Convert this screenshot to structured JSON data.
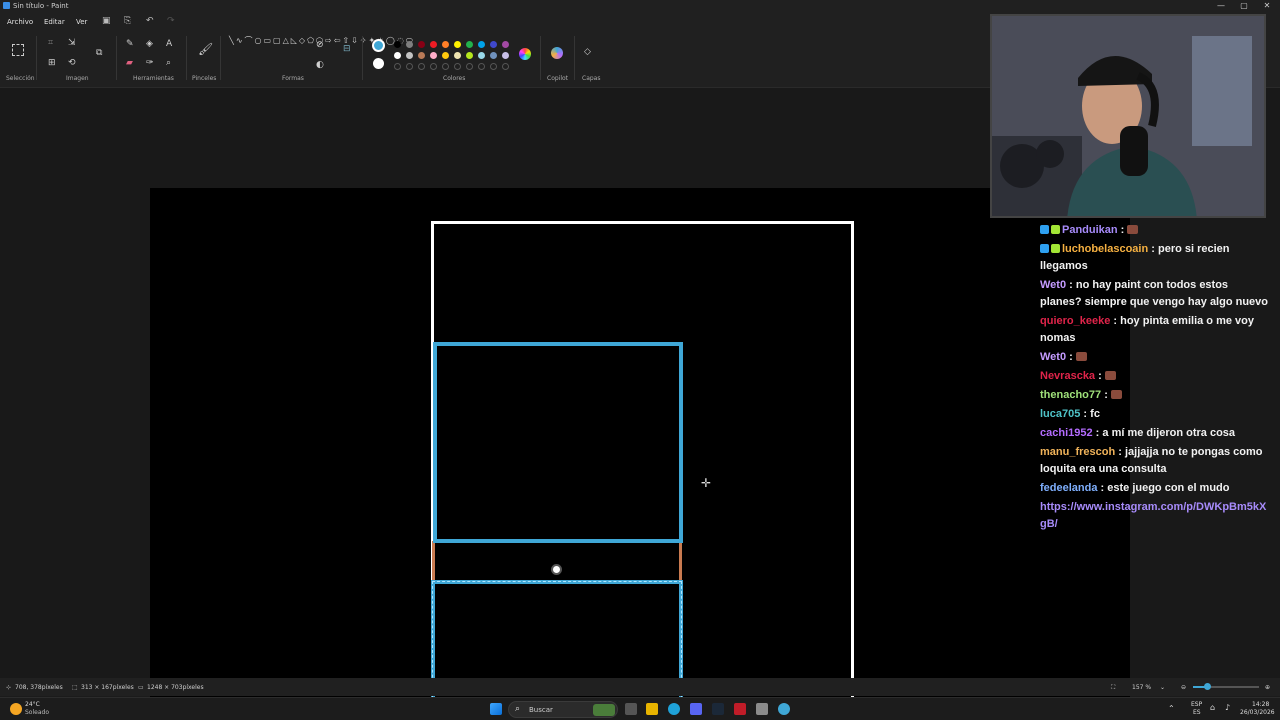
{
  "window": {
    "title": "Sin título - Paint",
    "controls": [
      "—",
      "▢",
      "✕"
    ]
  },
  "menu": {
    "items": [
      "Archivo",
      "Editar",
      "Ver"
    ]
  },
  "ribbon": {
    "groups": {
      "seleccion": "Selección",
      "imagen": "Imagen",
      "herramientas": "Herramientas",
      "pinceles": "Pinceles",
      "formas": "Formas",
      "colores": "Colores",
      "copilot": "Copilot",
      "capas": "Capas"
    },
    "colors": {
      "primary": "#3fa7d6",
      "secondary": "#ffffff",
      "palette_row1": [
        "#000000",
        "#7f7f7f",
        "#880015",
        "#ed1c24",
        "#ff7f27",
        "#fff200",
        "#22b14c",
        "#00a2e8",
        "#3f48cc",
        "#a349a4"
      ],
      "palette_row2": [
        "#ffffff",
        "#c3c3c3",
        "#b97a57",
        "#ffaec9",
        "#ffc90e",
        "#efe4b0",
        "#b5e61d",
        "#99d9ea",
        "#7092be",
        "#c8bfe7"
      ]
    }
  },
  "canvas": {
    "background": "#000000",
    "shape_colors": {
      "outline": "#ffffff",
      "blue": "#3fa7d6",
      "orange": "#c97a50"
    }
  },
  "chat": {
    "messages": [
      {
        "user": "Panduikan",
        "text": "",
        "color": "#a78bfa",
        "emote": true
      },
      {
        "user": "luchobelascoain",
        "text": "pero si recien llegamos",
        "color": "#f5b041"
      },
      {
        "user": "Wet0",
        "text": "no hay paint con todos estos planes? siempre que vengo hay algo nuevo",
        "color": "#c49bff"
      },
      {
        "user": "quiero_keeke",
        "text": "hoy pinta emilia o me voy nomas",
        "color": "#e0244a"
      },
      {
        "user": "Wet0",
        "text": "",
        "color": "#c49bff",
        "emote": true
      },
      {
        "user": "Nevrascka",
        "text": "",
        "color": "#e0244a",
        "emote": true
      },
      {
        "user": "thenacho77",
        "text": "",
        "color": "#9fe07a",
        "emote": true
      },
      {
        "user": "luca705",
        "text": "fc",
        "color": "#4fc3c8"
      },
      {
        "user": "cachi1952",
        "text": "a mí me dijeron otra cosa",
        "color": "#b46cff"
      },
      {
        "user": "manu_frescoh",
        "text": "jajjajja no te pongas como loquita era una consulta",
        "color": "#f0b35a"
      },
      {
        "user": "fedeelanda",
        "text": "este juego con el mudo",
        "color": "#7eaefc"
      }
    ],
    "link": "https://www.instagram.com/p/DWKpBm5kXgB/"
  },
  "statusbar": {
    "cursor": "708, 378píxeles",
    "selection": "313 × 167píxeles",
    "canvas_size": "1248 × 703píxeles",
    "zoom": "157 %"
  },
  "taskbar": {
    "weather_temp": "24°C",
    "weather_text": "Soleado",
    "search": "Buscar",
    "lang1": "ESP",
    "lang2": "ES",
    "time": "14:28",
    "date": "26/03/2026"
  }
}
